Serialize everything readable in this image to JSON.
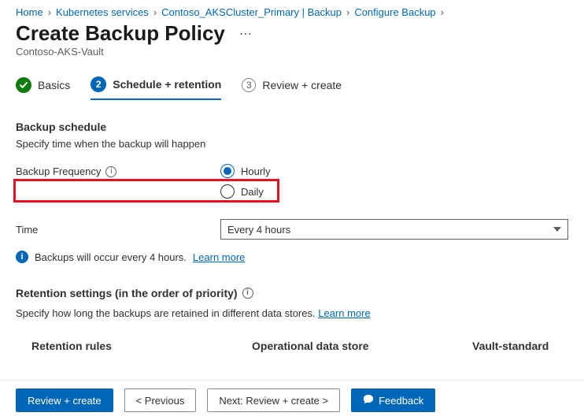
{
  "breadcrumb": {
    "items": [
      {
        "label": "Home"
      },
      {
        "label": "Kubernetes services"
      },
      {
        "label": "Contoso_AKSCluster_Primary | Backup"
      },
      {
        "label": "Configure Backup"
      }
    ]
  },
  "page": {
    "title": "Create Backup Policy",
    "subtitle": "Contoso-AKS-Vault"
  },
  "tabs": {
    "items": [
      {
        "label": "Basics",
        "state": "done"
      },
      {
        "label": "Schedule + retention",
        "state": "active",
        "num": "2"
      },
      {
        "label": "Review + create",
        "state": "todo",
        "num": "3"
      }
    ]
  },
  "schedule": {
    "heading": "Backup schedule",
    "sub": "Specify time when the backup will happen",
    "freq_label": "Backup Frequency",
    "options": {
      "hourly": "Hourly",
      "daily": "Daily"
    },
    "selected": "hourly",
    "time_label": "Time",
    "time_value": "Every 4 hours",
    "info_msg": "Backups will occur every 4 hours.",
    "learn_more": "Learn more"
  },
  "retention": {
    "heading": "Retention settings (in the order of priority)",
    "sub_prefix": "Specify how long the backups are retained in different data stores.",
    "learn_more": "Learn more",
    "cols": {
      "rules": "Retention rules",
      "op": "Operational data store",
      "vault": "Vault-standard"
    }
  },
  "footer": {
    "review": "Review + create",
    "prev": "< Previous",
    "next": "Next: Review + create >",
    "feedback": "Feedback"
  }
}
